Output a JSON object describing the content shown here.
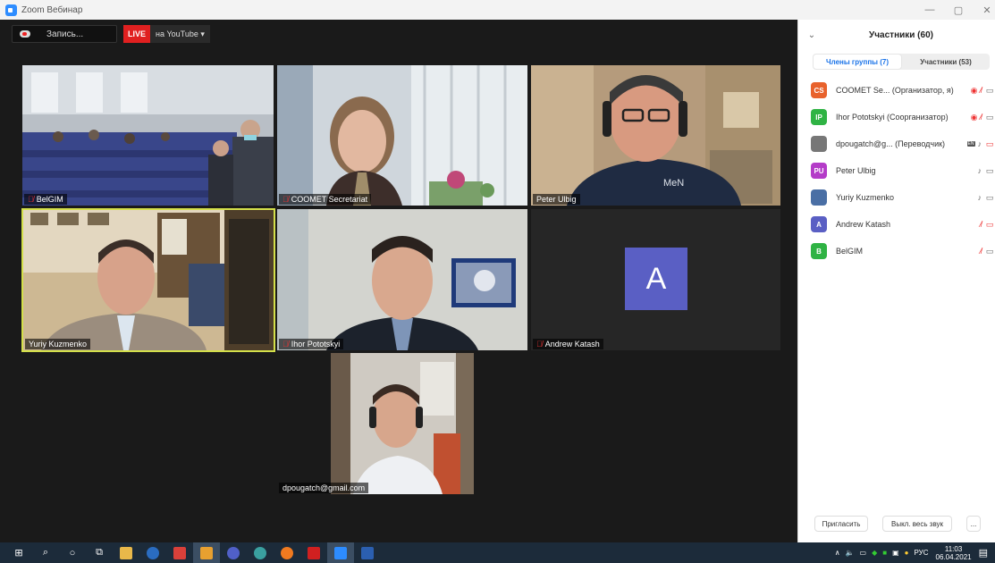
{
  "window": {
    "title": "Zoom Вебинар",
    "minimize": "—",
    "maximize": "▢",
    "close": "✕"
  },
  "toolbar": {
    "recording": "Запись...",
    "live": "LIVE",
    "stream_target": "на YouTube ▾"
  },
  "tiles": [
    {
      "name": "BelGIM",
      "muted": true
    },
    {
      "name": "COOMET Secretariat",
      "muted": true
    },
    {
      "name": "Peter Ulbig",
      "muted": false
    },
    {
      "name": "Yuriy Kuzmenko",
      "muted": false,
      "active": true
    },
    {
      "name": "Ihor Pototskyi",
      "muted": true
    },
    {
      "name": "Andrew Katash",
      "muted": true,
      "avatar_letter": "A"
    },
    {
      "name": "dpougatch@gmail.com",
      "muted": false
    }
  ],
  "scene_text": {
    "shirt_logo": "MeN"
  },
  "participants_panel": {
    "title": "Участники (60)",
    "tab_panelists": "Члены группы (7)",
    "tab_attendees": "Участники (53)",
    "rows": [
      {
        "initials": "CS",
        "color": "#e8622c",
        "label": "COOMET Se...  (Организатор, я)",
        "rec": true,
        "mic_off": true,
        "cam_off": false
      },
      {
        "initials": "IP",
        "color": "#2fb344",
        "label": "Ihor Pototskyi (Соорганизатор)",
        "rec": true,
        "mic_off": true,
        "cam_off": false
      },
      {
        "initials": "",
        "color": "#777777",
        "label": "dpougatch@g...  (Переводчик)",
        "en": "EN",
        "mic_off": false,
        "cam_off": true
      },
      {
        "initials": "PU",
        "color": "#b43cc8",
        "label": "Peter Ulbig",
        "mic_off": false,
        "cam_off": false
      },
      {
        "initials": "",
        "color": "#4a6fa5",
        "label": "Yuriy Kuzmenko",
        "mic_off": false,
        "cam_off": false
      },
      {
        "initials": "A",
        "color": "#5a5fc4",
        "label": "Andrew Katash",
        "mic_off": true,
        "cam_off": true
      },
      {
        "initials": "B",
        "color": "#2fb344",
        "label": "BelGIM",
        "mic_off": true,
        "cam_off": false
      }
    ],
    "invite_label": "Пригласить",
    "mute_all_label": "Выкл. весь звук",
    "more_label": "..."
  },
  "taskbar": {
    "lang": "РУС",
    "time": "11:03",
    "date": "06.04.2021"
  }
}
